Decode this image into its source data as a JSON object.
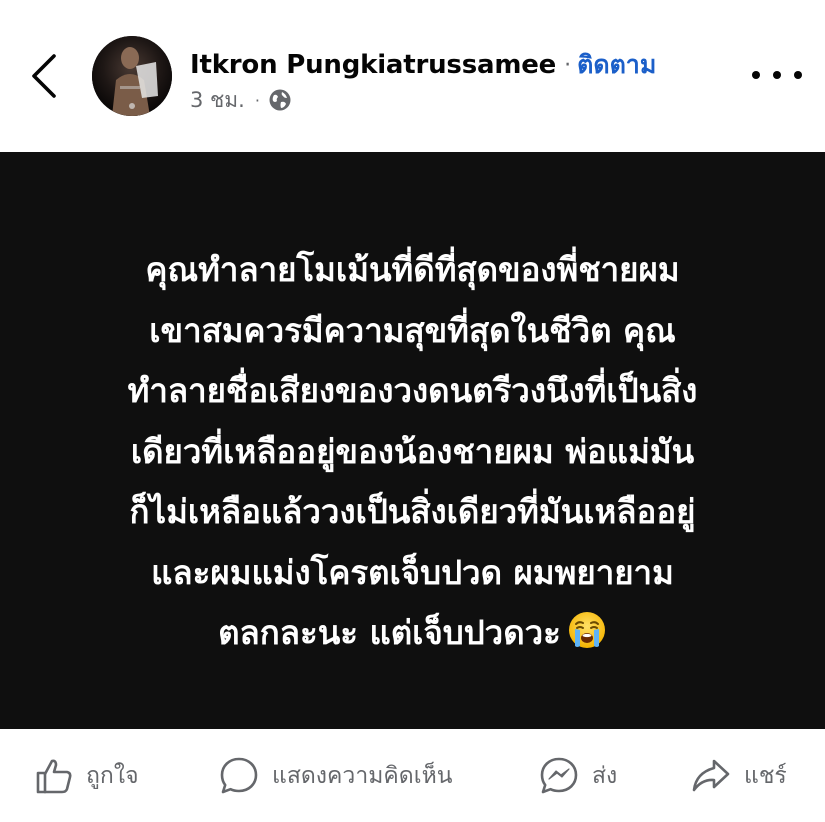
{
  "header": {
    "back_icon": "chevron-left-icon",
    "author_name": "Itkron Pungkiatrussamee",
    "separator": "·",
    "follow_label": "ติดตาม",
    "time_ago": "3 ชม.",
    "meta_separator": "·",
    "privacy_icon": "globe-icon",
    "more_icon": "more-horizontal-icon"
  },
  "post": {
    "background_color": "#0f0f0f",
    "text_color": "#ffffff",
    "lines": [
      "คุณทำลายโมเม้นที่ดีที่สุดของพี่ชายผม",
      "เขาสมควรมีความสุขที่สุดในชีวิต คุณ",
      "ทำลายชื่อเสียงของวงดนตรีวงนึงที่เป็นสิ่ง",
      "เดียวที่เหลืออยู่ของน้องชายผม พ่อแม่มัน",
      "ก็ไม่เหลือแล้ววงเป็นสิ่งเดียวที่มันเหลืออยู่",
      "และผมแม่งโครตเจ็บปวด ผมพยายาม",
      "ตลกละนะ แต่เจ็บปวดวะ"
    ],
    "emoji_icon": "loudly-crying-face-emoji"
  },
  "actions": {
    "like_label": "ถูกใจ",
    "comment_label": "แสดงความคิดเห็น",
    "send_label": "ส่ง",
    "share_label": "แชร์"
  },
  "colors": {
    "link_blue": "#1b5fc9",
    "secondary_text": "#65676b",
    "primary_text": "#050505"
  }
}
